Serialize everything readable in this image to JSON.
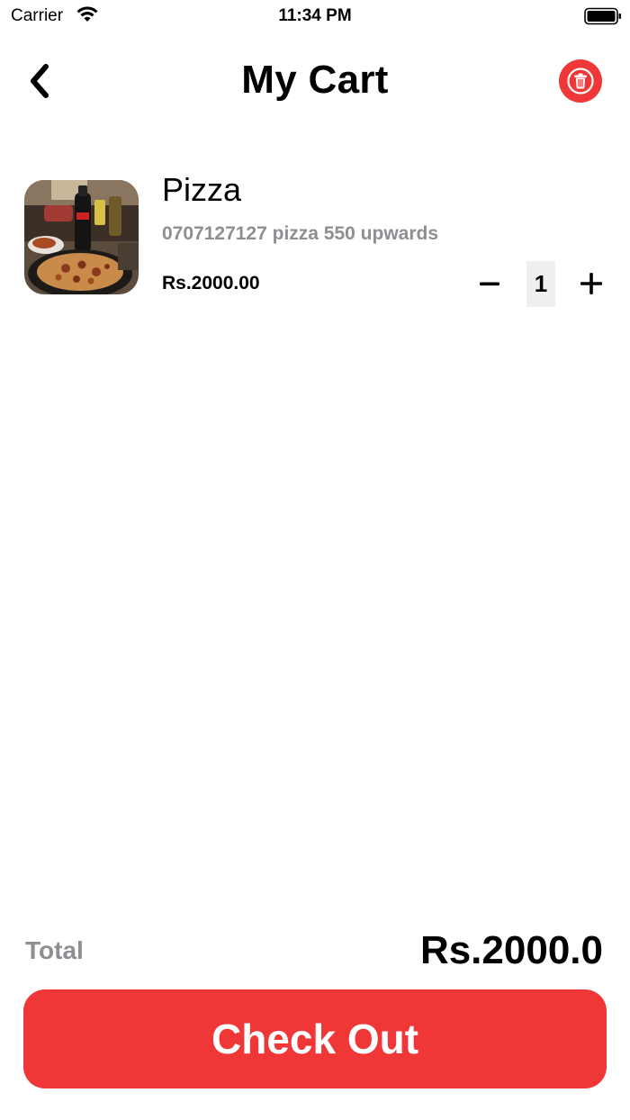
{
  "status_bar": {
    "carrier": "Carrier",
    "time": "11:34 PM",
    "icons": [
      "wifi-icon",
      "battery-icon"
    ]
  },
  "header": {
    "title": "My Cart",
    "back_icon": "chevron-left-icon",
    "trash_icon": "trash-icon",
    "accent_color": "#ef3737"
  },
  "cart": {
    "items": [
      {
        "name": "Pizza",
        "description": "0707127127 pizza 550 upwards",
        "price": "Rs.2000.00",
        "quantity": "1",
        "image": "pizza-photo"
      }
    ]
  },
  "footer": {
    "total_label": "Total",
    "total_value": "Rs.2000.0",
    "checkout_label": "Check Out",
    "checkout_color": "#ef3737"
  }
}
